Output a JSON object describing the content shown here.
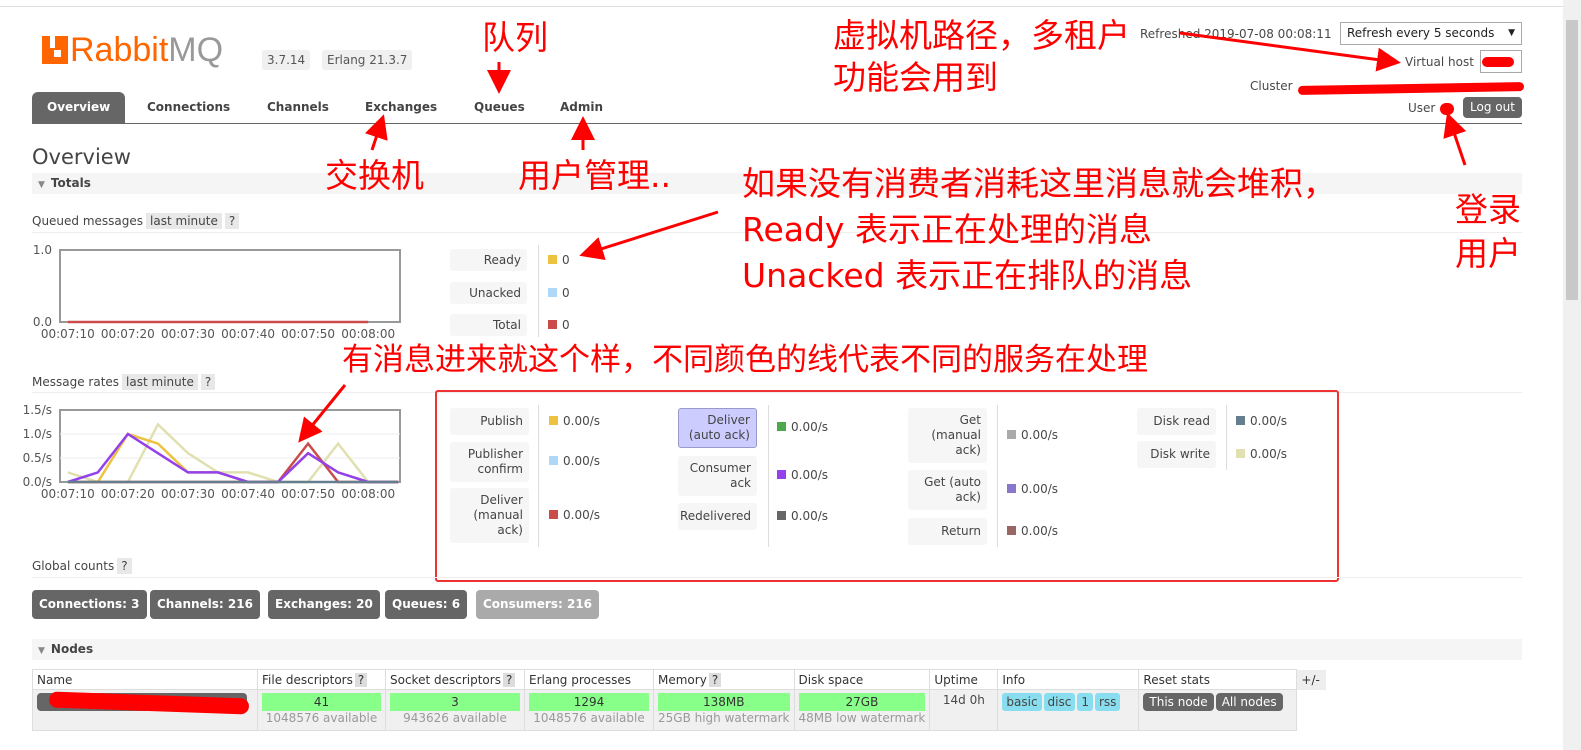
{
  "header": {
    "logo_rabbit": "Rabbit",
    "logo_mq": "MQ",
    "version": "3.7.14",
    "erlang": "Erlang 21.3.7",
    "refreshed": "Refreshed 2019-07-08 00:08:11",
    "refresh_select": "Refresh every 5 seconds",
    "virtual_host_label": "Virtual host",
    "cluster_label": "Cluster",
    "user_label": "User",
    "logout": "Log out"
  },
  "nav": {
    "tabs": [
      {
        "label": "Overview",
        "active": true
      },
      {
        "label": "Connections"
      },
      {
        "label": "Channels"
      },
      {
        "label": "Exchanges"
      },
      {
        "label": "Queues"
      },
      {
        "label": "Admin"
      }
    ]
  },
  "page_title": "Overview",
  "totals": {
    "section": "Totals",
    "queued_label": "Queued messages",
    "queued_range": "last minute",
    "help": "?",
    "queued_stats": [
      {
        "label": "Ready",
        "value": "0",
        "color": "#edc240"
      },
      {
        "label": "Unacked",
        "value": "0",
        "color": "#afd8f8"
      },
      {
        "label": "Total",
        "value": "0",
        "color": "#cb4b4b"
      }
    ],
    "rates_label": "Message rates",
    "rates_range": "last minute",
    "rates": [
      {
        "label": "Publish",
        "value": "0.00/s",
        "color": "#edc240"
      },
      {
        "label": "Publisher confirm",
        "value": "0.00/s",
        "color": "#afd8f8"
      },
      {
        "label": "Deliver (manual ack)",
        "value": "0.00/s",
        "color": "#cb4b4b"
      },
      {
        "label": "Deliver (auto ack)",
        "value": "0.00/s",
        "color": "#4da74d",
        "selected": true
      },
      {
        "label": "Consumer ack",
        "value": "0.00/s",
        "color": "#9440ed"
      },
      {
        "label": "Redelivered",
        "value": "0.00/s",
        "color": "#666666"
      },
      {
        "label": "Get (manual ack)",
        "value": "0.00/s",
        "color": "#aaaaaa"
      },
      {
        "label": "Get (auto ack)",
        "value": "0.00/s",
        "color": "#8877cc"
      },
      {
        "label": "Return",
        "value": "0.00/s",
        "color": "#996666"
      },
      {
        "label": "Disk read",
        "value": "0.00/s",
        "color": "#657e8f"
      },
      {
        "label": "Disk write",
        "value": "0.00/s",
        "color": "#e0e0b0"
      }
    ],
    "global_label": "Global counts",
    "counts": [
      {
        "label": "Connections:",
        "value": "3"
      },
      {
        "label": "Channels:",
        "value": "216"
      },
      {
        "label": "Exchanges:",
        "value": "20"
      },
      {
        "label": "Queues:",
        "value": "6"
      },
      {
        "label": "Consumers:",
        "value": "216"
      }
    ]
  },
  "chart_data": [
    {
      "type": "line",
      "title": "Queued messages",
      "x": [
        "00:07:10",
        "00:07:20",
        "00:07:30",
        "00:07:40",
        "00:07:50",
        "00:08:00"
      ],
      "xticks": [
        "00:07:10",
        "00:07:20",
        "00:07:30",
        "00:07:40",
        "00:07:50",
        "00:08:00"
      ],
      "yticks": [
        "0.0",
        "1.0"
      ],
      "ylim": [
        0,
        1
      ],
      "series": [
        {
          "color": "#cb4b4b",
          "values": [
            0,
            0,
            0,
            0,
            0,
            0
          ]
        }
      ]
    },
    {
      "type": "line",
      "title": "Message rates",
      "xticks": [
        "00:07:10",
        "00:07:20",
        "00:07:30",
        "00:07:40",
        "00:07:50",
        "00:08:00"
      ],
      "yticks": [
        "0.0/s",
        "0.5/s",
        "1.0/s",
        "1.5/s"
      ],
      "ylim": [
        0,
        1.5
      ],
      "x": [
        "00:07:10",
        "00:07:15",
        "00:07:20",
        "00:07:25",
        "00:07:30",
        "00:07:35",
        "00:07:40",
        "00:07:45",
        "00:07:50",
        "00:07:55",
        "00:08:00",
        "00:08:05"
      ],
      "series": [
        {
          "color": "#e0e0b0",
          "values": [
            0.2,
            0,
            0,
            1.2,
            0.6,
            0.2,
            0.2,
            0,
            0,
            0.8,
            0,
            0
          ]
        },
        {
          "color": "#edc240",
          "values": [
            0,
            0,
            1.0,
            0.8,
            0.2,
            0.2,
            0,
            0,
            0.6,
            0.2,
            0,
            0
          ]
        },
        {
          "color": "#cb4b4b",
          "values": [
            0,
            0,
            0,
            0,
            0,
            0,
            0,
            0,
            0.8,
            0,
            0,
            0
          ]
        },
        {
          "color": "#9440ed",
          "values": [
            0,
            0.2,
            1.0,
            0.6,
            0.2,
            0.2,
            0,
            0,
            0.6,
            0.2,
            0,
            0
          ]
        },
        {
          "color": "#657e8f",
          "values": [
            0,
            0,
            0,
            0,
            0,
            0,
            0,
            0,
            0,
            0,
            0,
            0
          ]
        }
      ]
    }
  ],
  "nodes": {
    "section": "Nodes",
    "columns": [
      "Name",
      "File descriptors",
      "Socket descriptors",
      "Erlang processes",
      "Memory",
      "Disk space",
      "Uptime",
      "Info",
      "Reset stats"
    ],
    "plusminus": "+/-",
    "row": {
      "fd": "41",
      "fd_sub": "1048576 available",
      "sd": "3",
      "sd_sub": "943626 available",
      "ep": "1294",
      "ep_sub": "1048576 available",
      "mem": "138MB",
      "mem_sub": "25GB high watermark",
      "disk": "27GB",
      "disk_sub": "48MB low watermark",
      "uptime": "14d 0h",
      "info": [
        "basic",
        "disc",
        "1",
        "rss"
      ],
      "reset": [
        "This node",
        "All nodes"
      ]
    }
  },
  "annotations": {
    "queues": "队列",
    "vhost1": "虚拟机路径，多租户",
    "vhost2": "功能会用到",
    "exchanges": "交换机",
    "admin": "用户管理..",
    "queued1": "如果没有消费者消耗这里消息就会堆积，",
    "queued2": "Ready 表示正在处理的消息",
    "queued3": "Unacked 表示正在排队的消息",
    "login1": "登录",
    "login2": "用户",
    "rates": "有消息进来就这个样，不同颜色的线代表不同的服务在处理"
  }
}
